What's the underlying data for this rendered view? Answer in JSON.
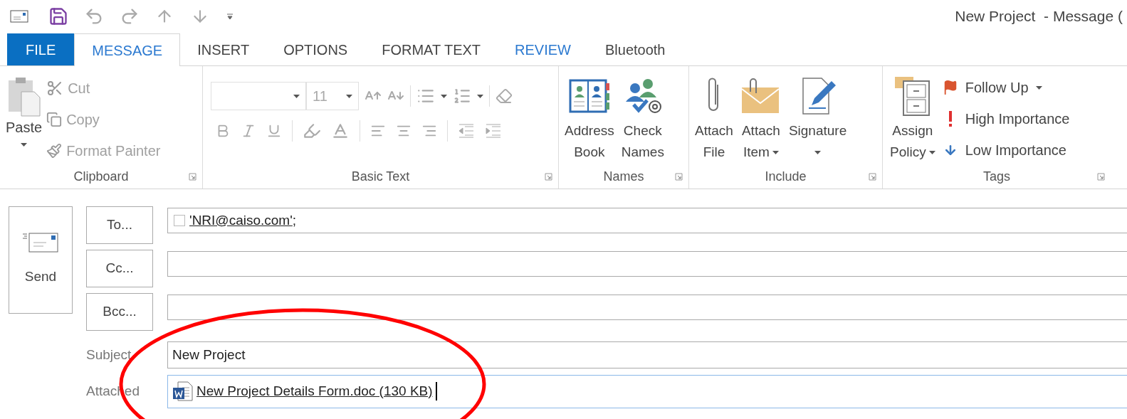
{
  "title": "New Project  - Message (",
  "tabs": [
    {
      "label": "FILE",
      "kind": "file",
      "selected": false
    },
    {
      "label": "MESSAGE",
      "kind": "tab",
      "selected": true
    },
    {
      "label": "INSERT",
      "kind": "tab",
      "selected": false
    },
    {
      "label": "OPTIONS",
      "kind": "tab",
      "selected": false
    },
    {
      "label": "FORMAT TEXT",
      "kind": "tab",
      "selected": false
    },
    {
      "label": "REVIEW",
      "kind": "accent",
      "selected": false
    },
    {
      "label": "Bluetooth",
      "kind": "tab",
      "selected": false
    }
  ],
  "clipboard": {
    "label": "Clipboard",
    "paste": {
      "lines": [
        "Paste"
      ],
      "dropdown": true
    },
    "commands": [
      {
        "label": "Cut",
        "kind": "cut",
        "disabled": true
      },
      {
        "label": "Copy",
        "kind": "copy",
        "disabled": true
      },
      {
        "label": "Format Painter",
        "kind": "brush",
        "disabled": true
      }
    ]
  },
  "basic_text": {
    "label": "Basic Text",
    "font_size": "11",
    "disabled": true
  },
  "names": {
    "label": "Names",
    "buttons": [
      {
        "lines": [
          "Address",
          "Book"
        ],
        "kind": "book",
        "dropdown": false
      },
      {
        "lines": [
          "Check",
          "Names"
        ],
        "kind": "people",
        "dropdown": false
      }
    ]
  },
  "include": {
    "label": "Include",
    "buttons": [
      {
        "lines": [
          "Attach",
          "File"
        ],
        "kind": "clip",
        "dropdown": false
      },
      {
        "lines": [
          "Attach",
          "Item"
        ],
        "kind": "envelope",
        "dropdown": true
      },
      {
        "lines": [
          "Signature"
        ],
        "kind": "signature",
        "dropdown": true
      }
    ]
  },
  "tags": {
    "label": "Tags",
    "policy": {
      "lines": [
        "Assign",
        "Policy"
      ],
      "kind": "policy",
      "dropdown": true
    },
    "commands": [
      {
        "label": "Follow Up",
        "kind": "flag",
        "dropdown": true
      },
      {
        "label": "High Importance",
        "kind": "high",
        "dropdown": false
      },
      {
        "label": "Low Importance",
        "kind": "low",
        "dropdown": false
      }
    ]
  },
  "send": {
    "label": "Send"
  },
  "recipients": [
    {
      "button": "To...",
      "addresses": [
        {
          "address": "'NRI@caiso.com'",
          "separator": ";"
        }
      ]
    },
    {
      "button": "Cc..."
    },
    {
      "button": "Bcc..."
    }
  ],
  "subject": {
    "label": "Subject",
    "value": "New Project"
  },
  "attached": {
    "label": "Attached",
    "file": "New Project Details Form.doc (130 KB)",
    "focused": true
  }
}
